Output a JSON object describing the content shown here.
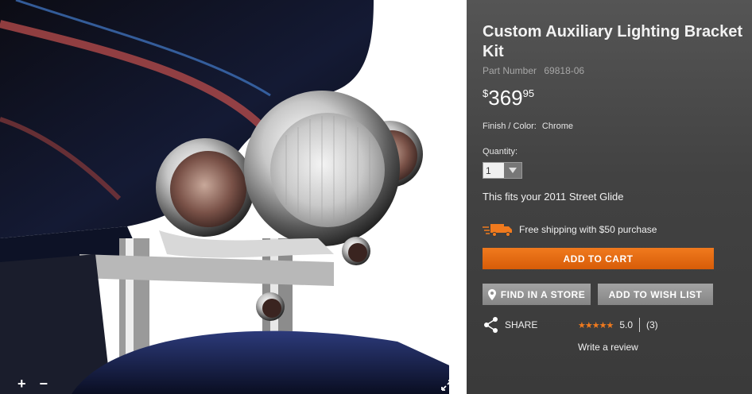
{
  "product": {
    "title": "Custom Auxiliary Lighting Bracket Kit",
    "part_label": "Part Number",
    "part_number": "69818-06",
    "price_currency": "$",
    "price_main": "369",
    "price_cents": "95",
    "finish_label": "Finish / Color:",
    "finish_value": "Chrome",
    "quantity_label": "Quantity:",
    "quantity_value": "1",
    "fits_text": "This fits your 2011 Street Glide",
    "shipping_text": "Free shipping with $50 purchase"
  },
  "actions": {
    "add_to_cart": "ADD TO CART",
    "find_in_store": "FIND IN A STORE",
    "add_to_wishlist": "ADD TO WISH LIST",
    "share": "SHARE",
    "write_review": "Write a review"
  },
  "rating": {
    "score": "5.0",
    "count": "(3)",
    "stars": "★★★★★"
  },
  "image": {
    "zoom_in": "+",
    "zoom_out": "−"
  },
  "colors": {
    "accent_orange": "#e8680f",
    "panel_bg": "#3a3a3a",
    "button_gray": "#959595"
  }
}
